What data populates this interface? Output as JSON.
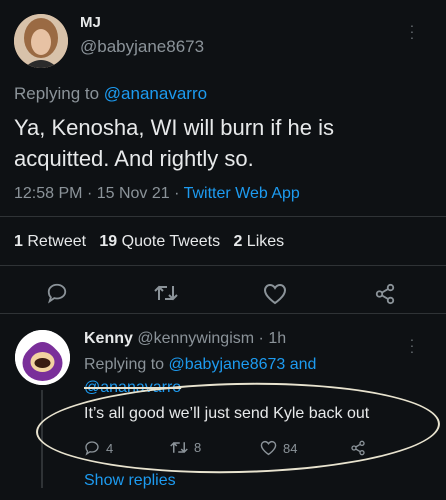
{
  "tweet": {
    "display_name": "MJ",
    "handle": "@babyjane8673",
    "replying_prefix": "Replying to",
    "replying_to": "@ananavarro",
    "text_line1": "Ya, Kenosha, WI will burn if he is",
    "text_line2": "acquitted. And rightly so.",
    "time": "12:58 PM",
    "date": "15 Nov 21",
    "source": "Twitter Web App",
    "stats": {
      "retweets_count": "1",
      "retweets_label": "Retweet",
      "quotes_count": "19",
      "quotes_label": "Quote Tweets",
      "likes_count": "2",
      "likes_label": "Likes"
    }
  },
  "reply": {
    "display_name": "Kenny",
    "handle": "@kennywingism",
    "time_ago": "1h",
    "replying_prefix": "Replying to",
    "replying_to": "@babyjane8673 and",
    "replying_to_2": "@ananavarro",
    "text": "It’s all good we’ll just send Kyle back out",
    "replies_count": "4",
    "retweets_count": "8",
    "likes_count": "84",
    "show_replies": "Show replies"
  },
  "colors": {
    "background": "#0e1114",
    "accent": "#1d9bf0",
    "text": "#e7e9ea",
    "muted": "#8b9399",
    "annotation": "#e8e3cf"
  },
  "icons": [
    "more-icon",
    "reply-icon",
    "retweet-icon",
    "like-icon",
    "share-icon"
  ]
}
